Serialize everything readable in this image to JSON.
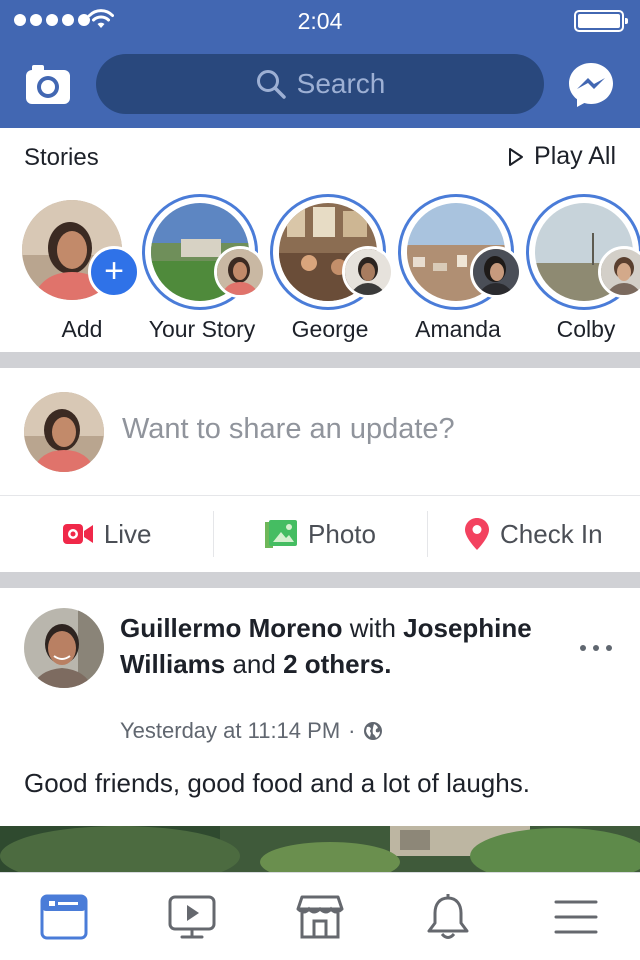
{
  "status_bar": {
    "time": "2:04"
  },
  "header": {
    "search_placeholder": "Search"
  },
  "stories": {
    "title": "Stories",
    "play_all": "Play All",
    "items": [
      {
        "name": "Add"
      },
      {
        "name": "Your Story"
      },
      {
        "name": "George"
      },
      {
        "name": "Amanda"
      },
      {
        "name": "Colby"
      }
    ]
  },
  "composer": {
    "placeholder": "Want to share an update?",
    "actions": [
      {
        "label": "Live",
        "icon": "live-video-icon",
        "color": "#f02849"
      },
      {
        "label": "Photo",
        "icon": "photo-icon",
        "color": "#45bd62"
      },
      {
        "label": "Check In",
        "icon": "location-pin-icon",
        "color": "#f3425f"
      }
    ]
  },
  "post": {
    "author": "Guillermo Moreno",
    "with_text": " with ",
    "tagged": "Josephine Williams",
    "and_text": " and ",
    "others": "2 others",
    "period": ".",
    "timestamp": "Yesterday at 11:14 PM",
    "meta_separator": "·",
    "privacy_icon": "globe-icon",
    "text": "Good friends, good food and a lot of laughs."
  },
  "tabbar": {
    "items": [
      {
        "icon": "news-feed-icon",
        "active": true
      },
      {
        "icon": "watch-video-icon",
        "active": false
      },
      {
        "icon": "marketplace-icon",
        "active": false
      },
      {
        "icon": "notifications-bell-icon",
        "active": false
      },
      {
        "icon": "menu-icon",
        "active": false
      }
    ]
  },
  "colors": {
    "brand_blue": "#4267b2",
    "search_bg": "#29487d",
    "story_ring": "#4a7cd8",
    "active_tab": "#4a7cd8"
  }
}
